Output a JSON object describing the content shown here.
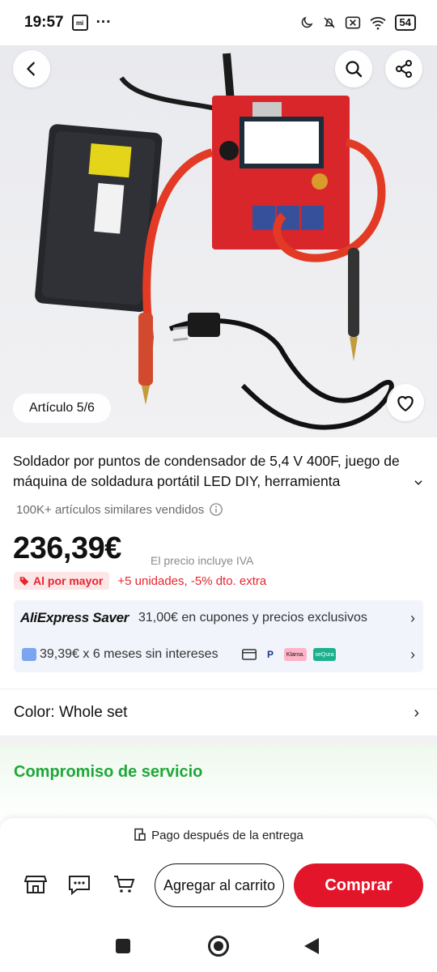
{
  "status_bar": {
    "time": "19:57",
    "dots": "···",
    "battery": "54",
    "icons": [
      "mi-icon",
      "moon-icon",
      "mute-bell-icon",
      "sim-off-icon",
      "wifi-icon",
      "battery-icon"
    ]
  },
  "hero": {
    "counter": "Artículo 5/6",
    "buttons": [
      "back-icon",
      "search-icon",
      "share-icon",
      "heart-icon"
    ]
  },
  "product": {
    "title": "Soldador por puntos de condensador de 5,4 V 400F, juego de máquina de soldadura portátil LED DIY, herramienta",
    "sold": "100K+ artículos similares vendidos",
    "price": "236,39€",
    "price_note": "El precio incluye IVA",
    "wholesale_badge": "Al por mayor",
    "wholesale_text": "+5 unidades, -5% dto. extra"
  },
  "promo": {
    "saver_brand": "AliExpress Saver",
    "saver_text": "31,00€ en cupones y precios exclusivos",
    "installments": "39,39€ x 6 meses sin intereses",
    "pay_labels": [
      "Klarna.",
      "seQura"
    ]
  },
  "options": {
    "color_label": "Color: Whole set"
  },
  "service": {
    "title": "Compromiso de servicio"
  },
  "bottom": {
    "pay_after": "Pago después de la entrega",
    "add_to_cart": "Agregar al carrito",
    "buy": "Comprar"
  },
  "colors": {
    "accent_red": "#e3152a",
    "green": "#1ea838"
  }
}
